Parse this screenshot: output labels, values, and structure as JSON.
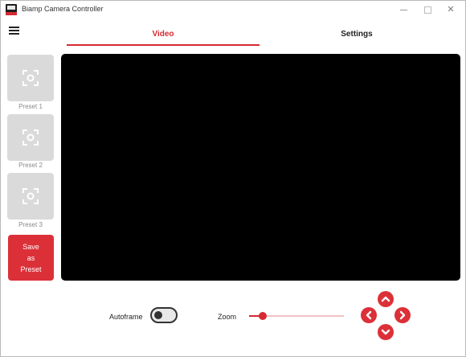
{
  "window": {
    "title": "Biamp Camera Controller",
    "close_glyph": "✕"
  },
  "menu": {
    "icon": "hamburger-menu-icon"
  },
  "tabs": [
    {
      "label": "Video",
      "active": true
    },
    {
      "label": "Settings",
      "active": false
    }
  ],
  "presets": [
    {
      "label": "Preset 1",
      "icon": "focus-target-icon"
    },
    {
      "label": "Preset 2",
      "icon": "focus-target-icon"
    },
    {
      "label": "Preset 3",
      "icon": "focus-target-icon"
    }
  ],
  "save_preset": {
    "label": "Save\nas\nPreset"
  },
  "controls": {
    "autoframe_label": "Autoframe",
    "autoframe_on": false,
    "zoom_label": "Zoom",
    "zoom_level": 0.14
  },
  "ptz": {
    "up_icon": "chevron-up-icon",
    "down_icon": "chevron-down-icon",
    "left_icon": "chevron-left-icon",
    "right_icon": "chevron-right-icon"
  },
  "colors": {
    "accent": "#d52a32",
    "preset_tile": "#dadada",
    "video_bg": "#000000"
  }
}
